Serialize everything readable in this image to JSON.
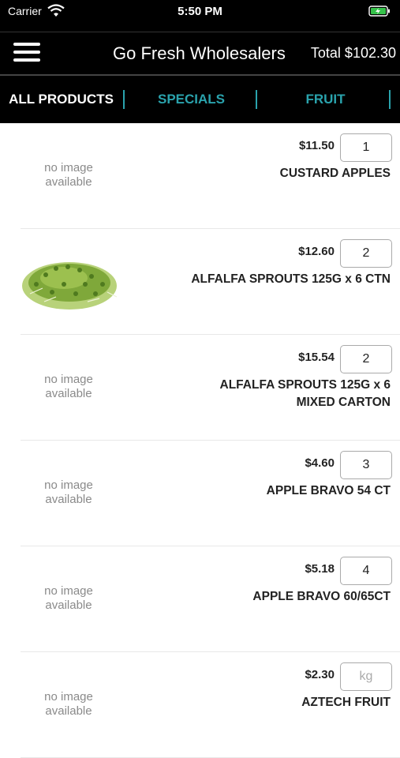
{
  "status_bar": {
    "carrier": "Carrier",
    "time": "5:50 PM"
  },
  "header": {
    "title": "Go Fresh Wholesalers",
    "total": "Total $102.30"
  },
  "tabs": [
    {
      "label": "ALL PRODUCTS"
    },
    {
      "label": "SPECIALS"
    },
    {
      "label": "FRUIT"
    }
  ],
  "no_image_text": "no image available",
  "products": [
    {
      "price": "$11.50",
      "qty": "1",
      "name": "CUSTARD APPLES",
      "has_image": false
    },
    {
      "price": "$12.60",
      "qty": "2",
      "name": "ALFALFA SPROUTS 125G x 6 CTN",
      "has_image": true,
      "image_icon": "alfalfa-sprouts-image"
    },
    {
      "price": "$15.54",
      "qty": "2",
      "name": "ALFALFA SPROUTS 125G x 6 MIXED CARTON",
      "has_image": false
    },
    {
      "price": "$4.60",
      "qty": "3",
      "name": "APPLE BRAVO 54 CT",
      "has_image": false
    },
    {
      "price": "$5.18",
      "qty": "4",
      "name": "APPLE BRAVO 60/65CT",
      "has_image": false
    },
    {
      "price": "$2.30",
      "qty": "",
      "qty_placeholder": "kg",
      "name": "AZTECH FRUIT",
      "has_image": false
    }
  ],
  "colors": {
    "accent": "#2aa3ad",
    "bar": "#000000"
  }
}
